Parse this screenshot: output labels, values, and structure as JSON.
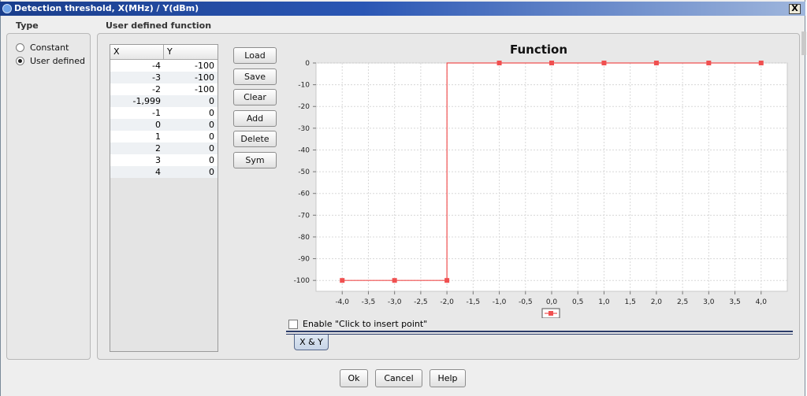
{
  "window": {
    "title": "Detection threshold, X(MHz) / Y(dBm)",
    "close_label": "X"
  },
  "type_panel": {
    "label": "Type",
    "options": [
      {
        "label": "Constant",
        "selected": false
      },
      {
        "label": "User defined",
        "selected": true
      }
    ]
  },
  "function_panel": {
    "label": "User defined function"
  },
  "table": {
    "headers": [
      "X",
      "Y"
    ],
    "rows": [
      {
        "x": "-4",
        "y": "-100"
      },
      {
        "x": "-3",
        "y": "-100"
      },
      {
        "x": "-2",
        "y": "-100"
      },
      {
        "x": "-1,999",
        "y": "0"
      },
      {
        "x": "-1",
        "y": "0"
      },
      {
        "x": "0",
        "y": "0"
      },
      {
        "x": "1",
        "y": "0"
      },
      {
        "x": "2",
        "y": "0"
      },
      {
        "x": "3",
        "y": "0"
      },
      {
        "x": "4",
        "y": "0"
      }
    ]
  },
  "buttons": {
    "load": "Load",
    "save": "Save",
    "clear": "Clear",
    "add": "Add",
    "delete": "Delete",
    "sym": "Sym"
  },
  "chart_data": {
    "type": "line",
    "title": "Function",
    "xlabel": "",
    "ylabel": "",
    "xlim": [
      -4.5,
      4.5
    ],
    "ylim": [
      -105,
      0
    ],
    "x_ticks": [
      "-4,0",
      "-3,5",
      "-3,0",
      "-2,5",
      "-2,0",
      "-1,5",
      "-1,0",
      "-0,5",
      "0,0",
      "0,5",
      "1,0",
      "1,5",
      "2,0",
      "2,5",
      "3,0",
      "3,5",
      "4,0"
    ],
    "x_tick_values": [
      -4,
      -3.5,
      -3,
      -2.5,
      -2,
      -1.5,
      -1,
      -0.5,
      0,
      0.5,
      1,
      1.5,
      2,
      2.5,
      3,
      3.5,
      4
    ],
    "y_ticks": [
      "0",
      "-10",
      "-20",
      "-30",
      "-40",
      "-50",
      "-60",
      "-70",
      "-80",
      "-90",
      "-100"
    ],
    "y_tick_values": [
      0,
      -10,
      -20,
      -30,
      -40,
      -50,
      -60,
      -70,
      -80,
      -90,
      -100
    ],
    "grid": true,
    "legend": "bottom-center",
    "series": [
      {
        "color": "#f05050",
        "x": [
          -4,
          -3,
          -2,
          -1.999,
          -1,
          0,
          1,
          2,
          3,
          4
        ],
        "y": [
          -100,
          -100,
          -100,
          0,
          0,
          0,
          0,
          0,
          0,
          0
        ]
      }
    ]
  },
  "checkbox": {
    "label": "Enable \"Click to insert point\"",
    "checked": false
  },
  "tabs": [
    {
      "label": "X & Y"
    }
  ],
  "dialog_buttons": {
    "ok": "Ok",
    "cancel": "Cancel",
    "help": "Help"
  }
}
